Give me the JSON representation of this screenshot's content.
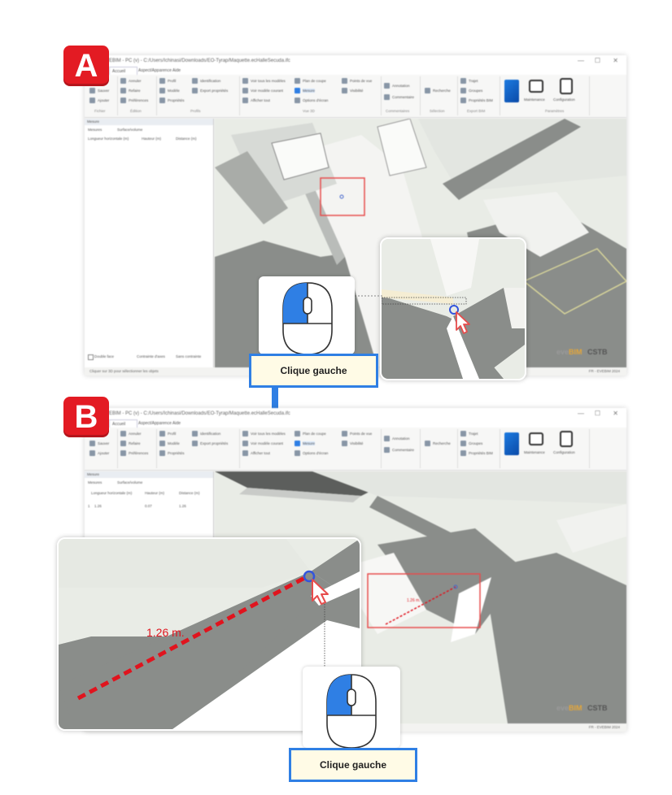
{
  "steps": {
    "a": "A",
    "b": "B"
  },
  "window": {
    "title": "EVEBIM - PC (v) - C:/Users/Ichinasi/Downloads/EO-Tyrap/Maquette.ecHalleSecuda.ifc",
    "tabs": [
      "Accueil",
      "Aspect/Apparence",
      "Aide"
    ],
    "ribbon_groups": [
      {
        "items": [
          "Ouvrir",
          "Sauver",
          "Ajouter"
        ],
        "caption": "Fichier"
      },
      {
        "items": [
          "Annuler",
          "Refaire",
          "Préférences"
        ],
        "caption": "Édition"
      },
      {
        "items": [
          "Profil",
          "Modèle",
          "Propriétés"
        ],
        "caption": "Profils"
      },
      {
        "items": [
          "Identification",
          "Export propriétés"
        ],
        "caption": ""
      },
      {
        "items": [
          "Voir tous les modèles",
          "Voir modèle courant",
          "Afficher tout"
        ],
        "caption": "Vue 3D"
      },
      {
        "items": [
          "Plan de coupe",
          "Mesure",
          "Options d'écran"
        ],
        "caption": ""
      },
      {
        "items": [
          "Points de vue",
          "Visibilité"
        ],
        "caption": ""
      },
      {
        "items": [
          "Annotation",
          "Commentaire"
        ],
        "caption": "Commentaires"
      },
      {
        "items": [
          "Recherche"
        ],
        "caption": "Sélection"
      },
      {
        "items": [
          "Trajet",
          "Groupes",
          "Propriétés BIM"
        ],
        "caption": "Export BIM"
      },
      {
        "items": [
          "Maintenance",
          "Configuration"
        ],
        "caption": "Paramètres"
      }
    ],
    "panel": {
      "title": "Mesure",
      "tabs": [
        "Mesures",
        "Surface/volume"
      ],
      "columns": [
        "Longueur horizontale (m)",
        "Hauteur (m)",
        "Distance (m)"
      ],
      "footer": {
        "checkbox": "Double face",
        "tabs": [
          "Contrainte d'axes",
          "Sans contrainte"
        ]
      }
    },
    "status_left": "Cliquer sur 3D pour sélectionner les objets",
    "status_right": "FR - EVEBIM 2024"
  },
  "measurement_row": {
    "index": "1",
    "horizontal": "1.26",
    "height": "0.07",
    "distance": "1.26"
  },
  "measure_label": "1.26 m.",
  "measure_label_small": "1.26 m.",
  "mouse_label": "Clique gauche",
  "watermark": {
    "eve": "eve",
    "bim": "BIM",
    "csto": "CSTB"
  },
  "colors": {
    "accent": "#2f7fe4",
    "badge": "#e31b23",
    "measure": "#e0141e",
    "wall_gray": "#8a8d8a",
    "floor_light": "#e9ece6"
  }
}
